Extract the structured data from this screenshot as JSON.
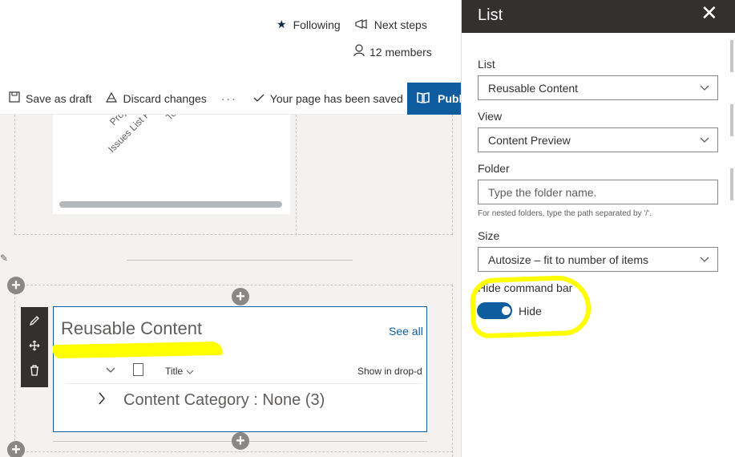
{
  "header": {
    "following_label": "Following",
    "next_steps_label": "Next steps",
    "members_label": "12 members"
  },
  "toolbar": {
    "save_draft_label": "Save as draft",
    "discard_label": "Discard changes",
    "more_label": "···",
    "saved_status": "Your page has been saved",
    "publish_label": "Publish"
  },
  "chart": {
    "axis_labels": [
      "Projec",
      "Issues List Fou",
      "To"
    ]
  },
  "webpart": {
    "title": "Reusable Content",
    "see_all_label": "See all",
    "columns": {
      "title": "Title",
      "show_in": "Show in drop-d"
    },
    "group_label": "Content Category : None (3)"
  },
  "panel": {
    "title": "List",
    "close_label": "✕",
    "list_label": "List",
    "list_value": "Reusable Content",
    "view_label": "View",
    "view_value": "Content Preview",
    "folder_label": "Folder",
    "folder_placeholder": "Type the folder name.",
    "folder_help": "For nested folders, type the path separated by '/'.",
    "size_label": "Size",
    "size_value": "Autosize – fit to number of items",
    "hide_cmd_label": "Hide command bar",
    "toggle_label": "Hide",
    "toggle_on": true
  },
  "colors": {
    "accent": "#0f5c9e",
    "highlight": "#ffff00",
    "panel_header": "#323130"
  }
}
